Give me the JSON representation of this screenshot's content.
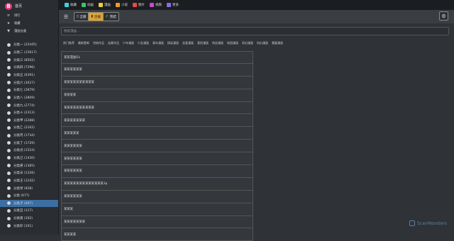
{
  "brand": {
    "logo_letter": "B",
    "name": "首页"
  },
  "sidebar": {
    "menu": [
      {
        "label": "排行",
        "icon": "list-icon"
      },
      {
        "label": "收藏",
        "icon": "star-icon"
      },
      {
        "label": "漫画分类",
        "icon": "filter-icon"
      }
    ],
    "categories": [
      {
        "label": "分类一 (22445)"
      },
      {
        "label": "分类二 (15617)"
      },
      {
        "label": "分类三 (8502)"
      },
      {
        "label": "分类四 (7296)"
      },
      {
        "label": "分类五 (6391)"
      },
      {
        "label": "分类六 (3027)"
      },
      {
        "label": "分类七 (2879)"
      },
      {
        "label": "分类八 (2809)"
      },
      {
        "label": "分类九 (2774)"
      },
      {
        "label": "分类十 (2313)"
      },
      {
        "label": "分类甲 (2288)"
      },
      {
        "label": "分类乙 (2162)"
      },
      {
        "label": "分类丙 (1734)"
      },
      {
        "label": "分类丁 (1729)"
      },
      {
        "label": "分类戊 (1524)"
      },
      {
        "label": "分类己 (1430)"
      },
      {
        "label": "分类庚 (1385)"
      },
      {
        "label": "分类辛 (1326)"
      },
      {
        "label": "分类壬 (1242)"
      },
      {
        "label": "分类癸 (928)"
      },
      {
        "label": "分类 (677)"
      },
      {
        "label": "分类子 (407)",
        "active": true
      },
      {
        "label": "分类丑 (117)"
      },
      {
        "label": "分类寅 (102)"
      },
      {
        "label": "分类卯 (101)"
      }
    ]
  },
  "topnav": [
    {
      "label": "收藏",
      "icon": "heart-icon",
      "color": "#3fd0e0"
    },
    {
      "label": "动画",
      "icon": "film-icon",
      "color": "#3cc46a"
    },
    {
      "label": "漫画",
      "icon": "book-icon",
      "color": "#e8d13a"
    },
    {
      "label": "小说",
      "icon": "novel-icon",
      "color": "#e89a2e"
    },
    {
      "label": "图片",
      "icon": "image-icon",
      "color": "#e84a4a"
    },
    {
      "label": "视频",
      "icon": "video-icon",
      "color": "#c84ad0"
    },
    {
      "label": "更多",
      "icon": "gamepad-icon",
      "color": "#8a6ae8"
    }
  ],
  "toolbar": {
    "buttons": [
      {
        "label": "全部",
        "icon": "file-icon"
      },
      {
        "label": "连载",
        "icon": "pages-icon",
        "active": true
      },
      {
        "label": "完结",
        "icon": "check-icon"
      }
    ]
  },
  "search": {
    "placeholder": "搜索漫画..."
  },
  "tags": [
    "热门推荐",
    "最新更新",
    "完结作品",
    "连载作品",
    "少年漫画",
    "少女漫画",
    "青年漫画",
    "搞笑漫画",
    "恋爱漫画",
    "冒险漫画",
    "热血漫画",
    "校园漫画",
    "奇幻漫画",
    "科幻漫画",
    "悬疑漫画"
  ],
  "list": [
    "某某漫画OL",
    "某某某某某某",
    "某某某某某某某某某某",
    "某某某某",
    "某某某某某某某某某某",
    "某某某某某某某",
    "某某某某某",
    "某某某某某某",
    "某某某某某某",
    "某某某某某某",
    "某某某某某某某某某某某某某3p",
    "某某某某某某",
    "某某某",
    "某某某某某某某",
    "某某某某"
  ],
  "watermark": "ScanMonsters"
}
